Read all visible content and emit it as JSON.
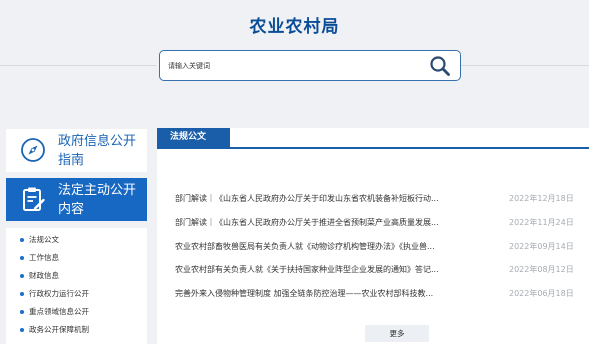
{
  "header": {
    "site_title": "农业农村局",
    "search": {
      "placeholder": "请输入关键词",
      "value": ""
    }
  },
  "sidebar": {
    "nav_cards": [
      {
        "label": "政府信息公开指南",
        "icon": "compass-icon",
        "active": false
      },
      {
        "label": "法定主动公开内容",
        "icon": "clipboard-edit-icon",
        "active": true
      }
    ],
    "sub_items": [
      "法规公文",
      "工作信息",
      "财政信息",
      "行政权力运行公开",
      "重点领域信息公开",
      "政务公开保障机制"
    ]
  },
  "main": {
    "section_title": "法规公文",
    "articles": [
      {
        "title": "部门解读｜《山东省人民政府办公厅关于印发山东省农机装备补短板行动...",
        "date": "2022年12月18日"
      },
      {
        "title": "部门解读｜《山东省人民政府办公厅关于推进全省预制菜产业高质量发展...",
        "date": "2022年11月24日"
      },
      {
        "title": "农业农村部畜牧兽医局有关负责人就《动物诊疗机构管理办法》《执业兽...",
        "date": "2022年09月14日"
      },
      {
        "title": "农业农村部有关负责人就《关于扶持国家种业阵型企业发展的通知》答记...",
        "date": "2022年08月12日"
      },
      {
        "title": "完善外来入侵物种管理制度 加强全链条防控治理——农业农村部科技教...",
        "date": "2022年06月18日"
      }
    ],
    "more_label": "更多"
  },
  "colors": {
    "brand_blue": "#0a4d97",
    "active_nav": "#1768c2",
    "panel_accent": "#1a5da8",
    "date_gray": "#a6abb3",
    "background": "#f0f1f4"
  }
}
